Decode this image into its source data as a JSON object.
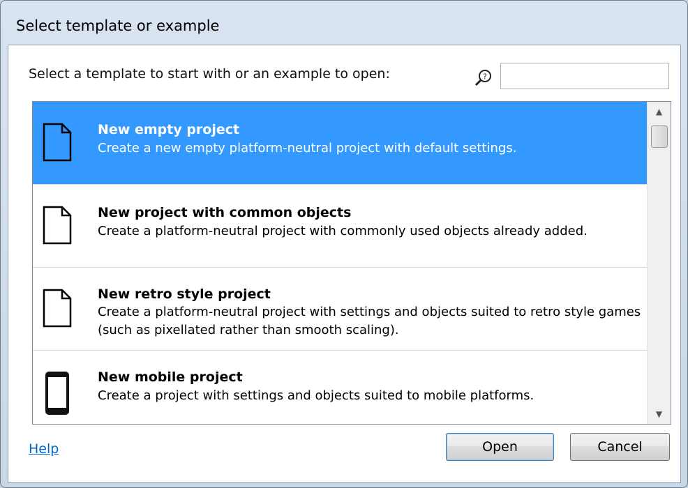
{
  "dialog": {
    "title": "Select template or example",
    "prompt": "Select a template to start with or an example to open:",
    "search": {
      "value": "",
      "placeholder": ""
    }
  },
  "list": {
    "items": [
      {
        "title": "New empty project",
        "description": "Create a new empty platform-neutral project with default settings.",
        "icon": "document-icon",
        "selected": true
      },
      {
        "title": "New project with common objects",
        "description": "Create a platform-neutral project with commonly used objects already added.",
        "icon": "document-icon",
        "selected": false
      },
      {
        "title": "New retro style project",
        "description": "Create a platform-neutral project with settings and objects suited to retro style games (such as pixellated rather than smooth scaling).",
        "icon": "document-icon",
        "selected": false
      },
      {
        "title": "New mobile project",
        "description": "Create a project with settings and objects suited to mobile platforms.",
        "icon": "mobile-phone-icon",
        "selected": false
      }
    ]
  },
  "footer": {
    "help_label": "Help",
    "open_label": "Open",
    "cancel_label": "Cancel"
  },
  "colors": {
    "selection": "#3399ff",
    "link": "#0066cc"
  }
}
